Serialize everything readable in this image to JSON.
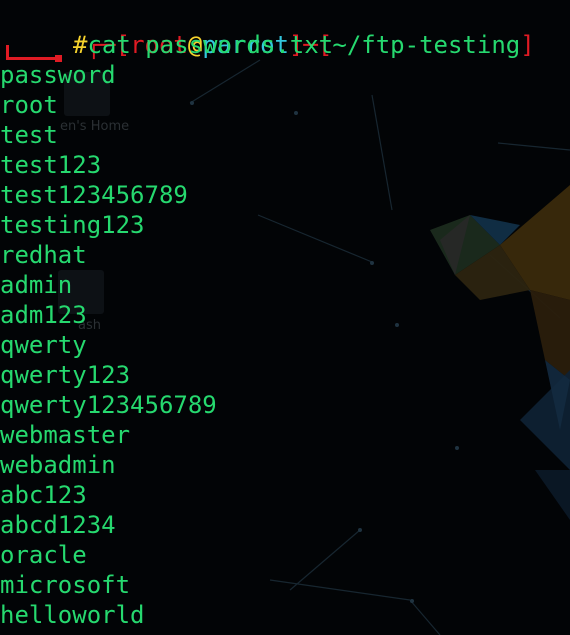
{
  "prompt": {
    "open_bracket": "┌─[",
    "user": "root",
    "at": "@",
    "host": "parrot",
    "separator": "]─[",
    "cwd": "~/ftp-testing",
    "close_bracket": "]",
    "hash": "#",
    "command": "cat passwords.txt"
  },
  "output_lines": [
    "password",
    "root",
    "test",
    "test123",
    "test123456789",
    "testing123",
    "redhat",
    "admin",
    "adm123",
    "qwerty",
    "qwerty123",
    "qwerty123456789",
    "webmaster",
    "webadmin",
    "abc123",
    "abcd1234",
    "oracle",
    "microsoft",
    "helloworld"
  ],
  "wallpaper": {
    "home_icon_label": "en's Home",
    "trash_icon_label": "ash"
  },
  "colors": {
    "background": "#020406",
    "prompt_red": "#e01b24",
    "prompt_yellow": "#f6d32d",
    "prompt_cyan": "#33c7de",
    "text_green": "#26d96f"
  }
}
